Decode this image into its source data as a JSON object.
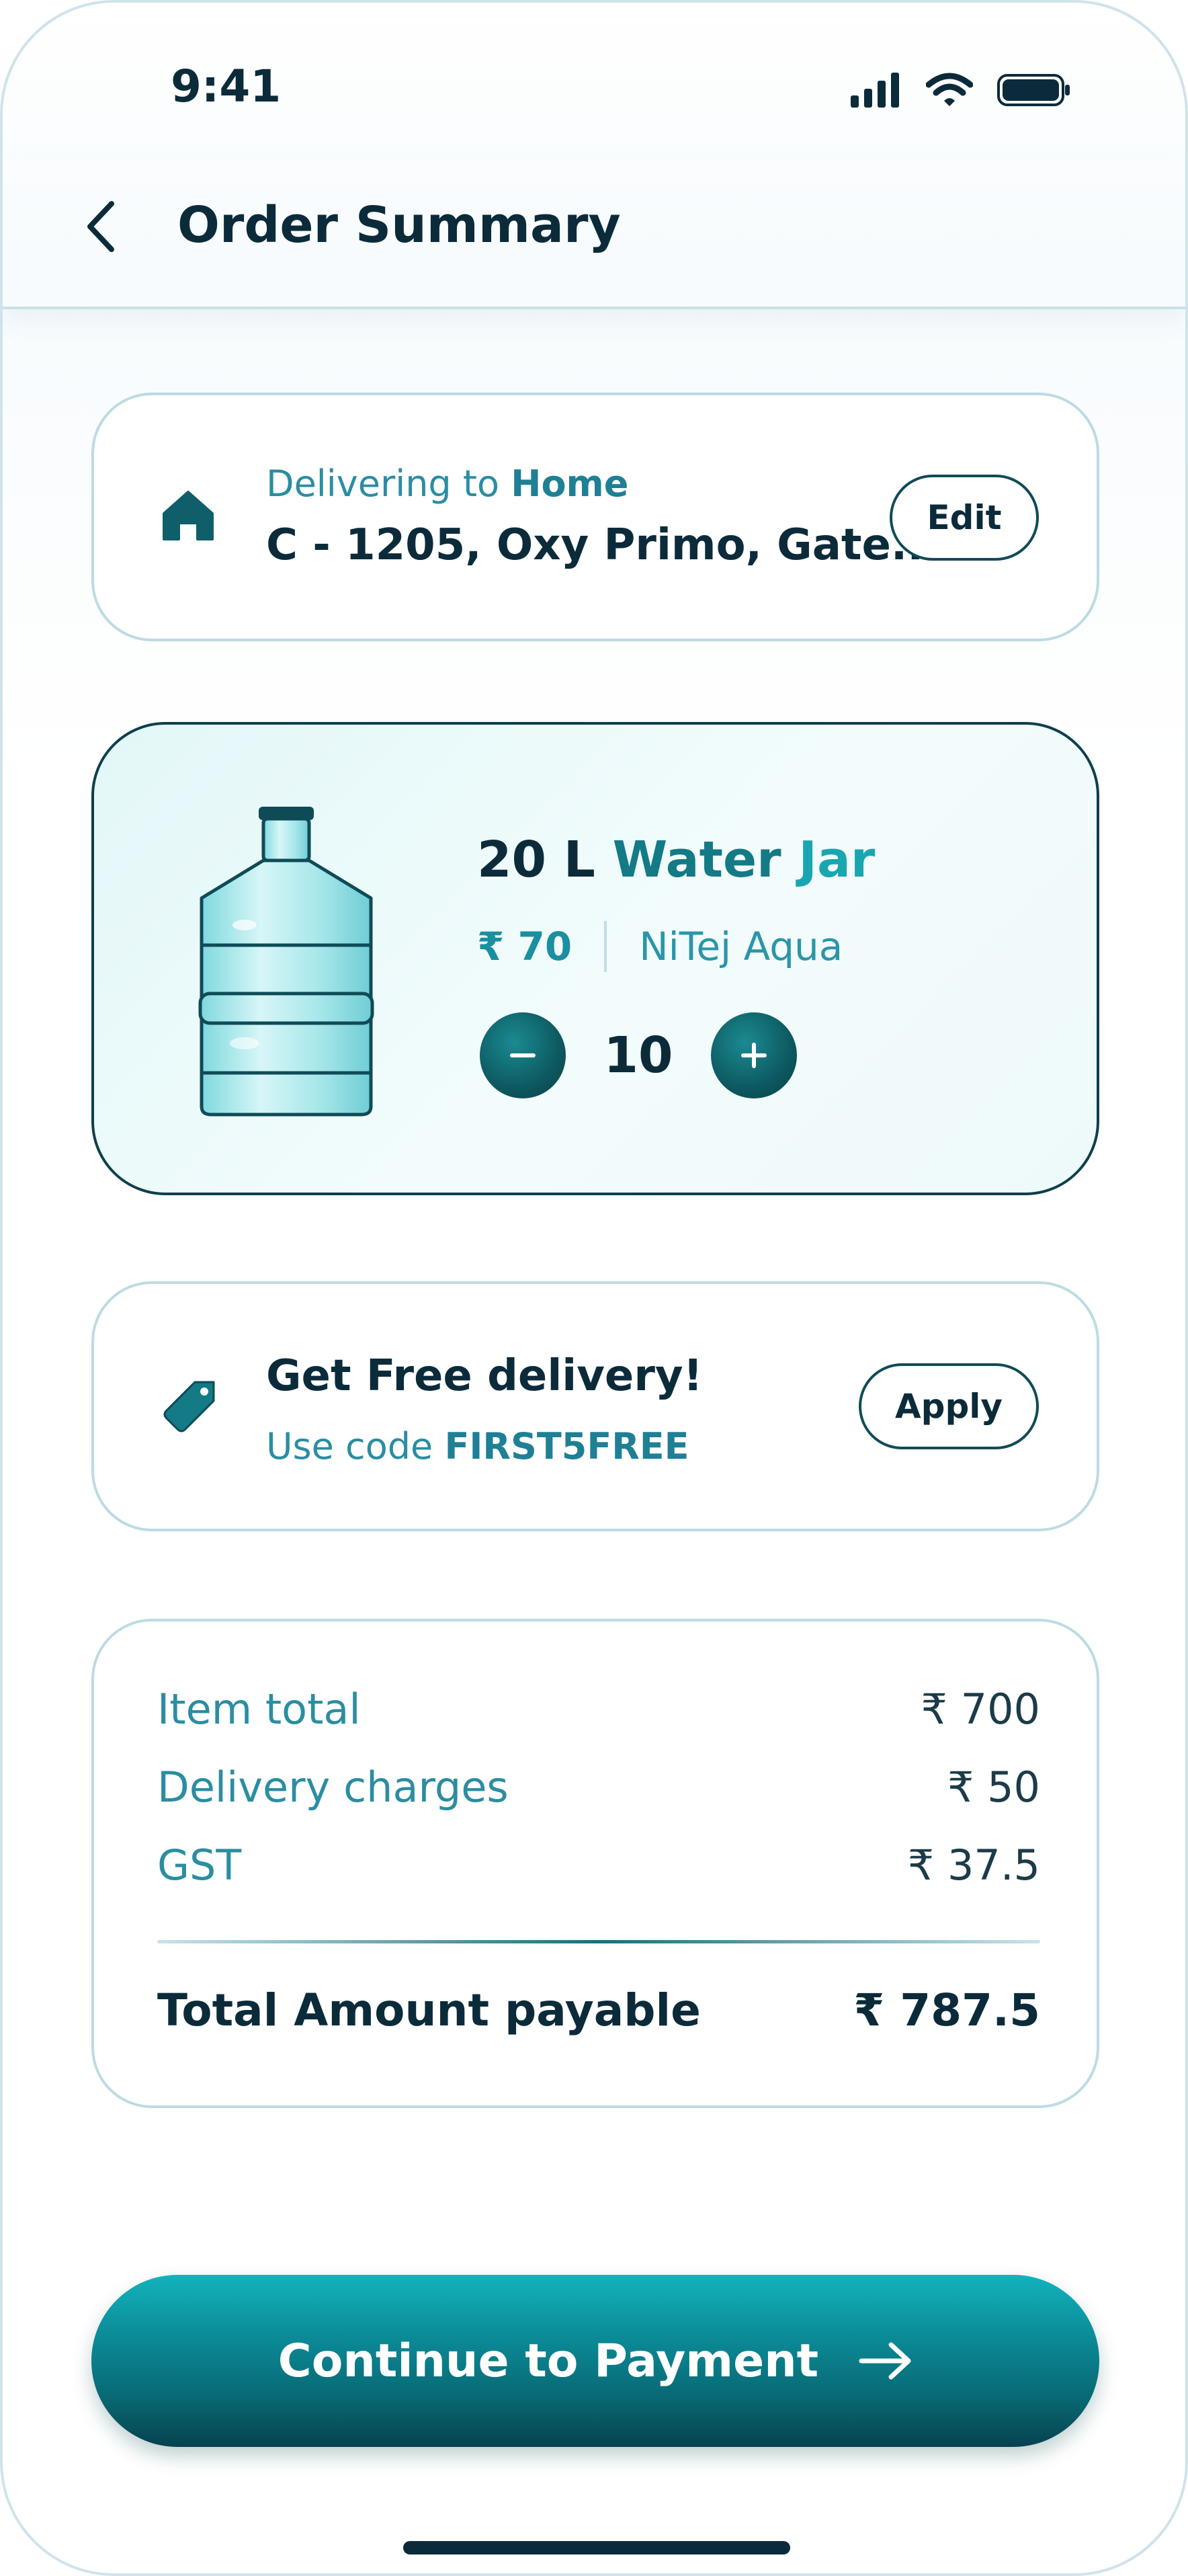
{
  "status_bar": {
    "time": "9:41",
    "icons": [
      "signal-icon",
      "wifi-icon",
      "battery-icon"
    ]
  },
  "header": {
    "title": "Order Summary",
    "back_icon": "chevron-left-icon"
  },
  "address": {
    "label_prefix": "Delivering to",
    "label_place": "Home",
    "text": "C - 1205, Oxy Primo, Gate...",
    "edit_label": "Edit",
    "icon": "home-icon"
  },
  "product": {
    "name_part1": "20 L",
    "name_part2": "Water",
    "name_part3": "Jar",
    "price": "₹ 70",
    "brand": "NiTej Aqua",
    "quantity": "10",
    "icon": "water-jar-image"
  },
  "promo": {
    "title": "Get Free delivery!",
    "sub_prefix": "Use code",
    "code": "FIRST5FREE",
    "apply_label": "Apply",
    "icon": "tag-icon"
  },
  "bill": {
    "rows": [
      {
        "label": "Item total",
        "value": "₹ 700"
      },
      {
        "label": "Delivery charges",
        "value": "₹ 50"
      },
      {
        "label": "GST",
        "value": "₹ 37.5"
      }
    ],
    "total_label": "Total Amount payable",
    "total_value": "₹ 787.5"
  },
  "cta": {
    "label": "Continue to Payment",
    "icon": "arrow-right-icon"
  },
  "colors": {
    "accent": "#0b8c98",
    "dark": "#0c2b3a",
    "teal_text": "#2b8da2"
  }
}
